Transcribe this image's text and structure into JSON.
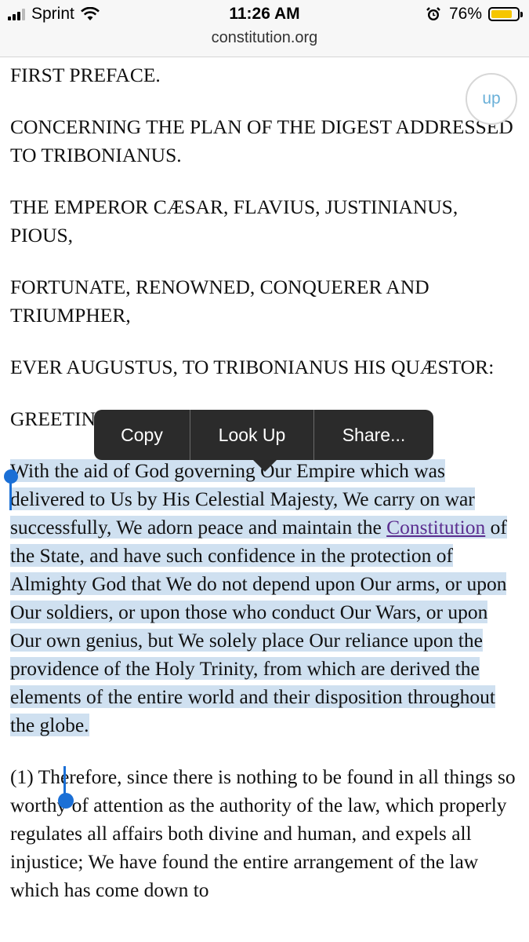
{
  "status_bar": {
    "carrier": "Sprint",
    "time": "11:26 AM",
    "battery": "76%",
    "battery_color": "#f6c600",
    "icons": [
      "signal-icon",
      "wifi-icon",
      "alarm-icon",
      "battery-icon"
    ]
  },
  "browser": {
    "url": "constitution.org"
  },
  "up_button": {
    "label": "up"
  },
  "content": {
    "heading1": "FIRST PREFACE.",
    "heading2": "CONCERNING THE PLAN OF THE DIGEST ADDRESSED TO TRIBONIANUS.",
    "heading3": "THE EMPEROR CÆSAR, FLAVIUS, JUSTINIANUS, PIOUS,",
    "heading4": "FORTUNATE, RENOWNED, CONQUERER AND TRIUMPHER,",
    "heading5": "EVER AUGUSTUS, TO TRIBONIANUS HIS QUÆSTOR:",
    "greeting": "GREETING.",
    "para1_before_link": "With the aid of God governing Our Empire which was delivered to Us by His Celestial Majesty, We carry on war successfully, We adorn peace and maintain the ",
    "para1_link": "Constitution",
    "para1_after_link": " of the State, and have such confidence in the protection of Almighty God that We do not depend upon Our arms, or upon Our soldiers, or upon those who conduct Our Wars, or upon Our own genius, but We solely place Our reliance upon the providence of the Holy Trinity, from which are derived the elements of the entire world and their disposition throughout the globe.",
    "para2": "(1) Therefore, since there is nothing to be found in all things so worthy of attention as the authority of the law, which properly regulates all affairs both divine and human, and expels all injustice; We have found the entire arrangement of the law which has come down to"
  },
  "context_menu": {
    "copy": "Copy",
    "look_up": "Look Up",
    "share": "Share..."
  },
  "colors": {
    "selection": "#cfe0f0",
    "handle": "#1a6fd6",
    "link": "#5b2d8f",
    "up_text": "#6ab0d8",
    "menu_bg": "#2b2b2b"
  }
}
